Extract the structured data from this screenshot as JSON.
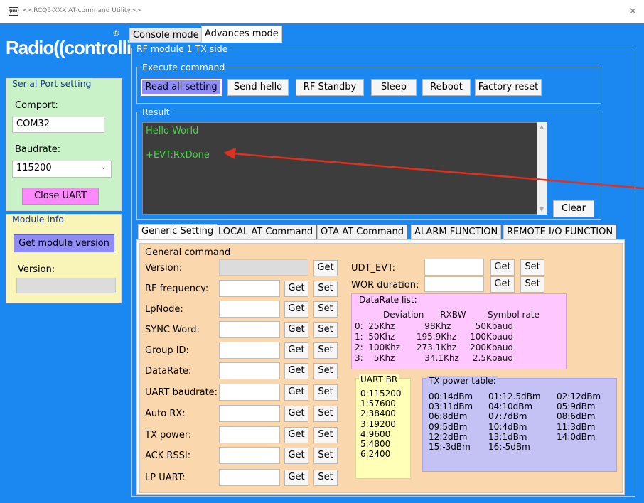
{
  "window": {
    "title": "<<RCQ5-XXX AT-command Utility>>",
    "app_icon_text": "(ini)",
    "close_glyph": "×"
  },
  "branding": {
    "logo_text": "Radio((controlli",
    "registered_mark": "®"
  },
  "serial_port": {
    "group_label": "Serial Port setting",
    "comport_label": "Comport:",
    "comport_value": "COM32",
    "baudrate_label": "Baudrate:",
    "baudrate_value": "115200",
    "close_button": "Close UART"
  },
  "module_info": {
    "group_label": "Module info",
    "get_version_button": "Get module version",
    "version_label": "Version:",
    "version_value": ""
  },
  "mode_tabs": [
    "Console mode",
    "Advances mode"
  ],
  "rf_module": {
    "group_label": "RF module 1 TX side",
    "execute_label": "Execute command",
    "commands": [
      "Read all setting",
      "Send hello",
      "RF Standby",
      "Sleep",
      "Reboot",
      "Factory reset"
    ],
    "result_label": "Result",
    "result_lines": [
      "Hello World",
      "+EVT:RxDone"
    ],
    "clear_button": "Clear"
  },
  "settings_tabs": [
    "Generic Setting",
    "LOCAL AT Command",
    "OTA AT Command",
    "ALARM FUNCTION",
    "REMOTE I/O FUNCTION"
  ],
  "general": {
    "group_label": "General command",
    "get": "Get",
    "set": "Set",
    "rows": [
      {
        "label": "Version:",
        "has_set": false
      },
      {
        "label": "RF frequency:",
        "has_set": true
      },
      {
        "label": "LpNode:",
        "has_set": true
      },
      {
        "label": "SYNC Word:",
        "has_set": true
      },
      {
        "label": "Group ID:",
        "has_set": true
      },
      {
        "label": "DataRate:",
        "has_set": true
      },
      {
        "label": "UART baudrate:",
        "has_set": true
      },
      {
        "label": "Auto RX:",
        "has_set": true
      },
      {
        "label": "TX power:",
        "has_set": true
      },
      {
        "label": "ACK RSSI:",
        "has_set": true
      },
      {
        "label": "LP UART:",
        "has_set": true
      }
    ],
    "udt_evt_label": "UDT_EVT:",
    "wor_label": "WOR duration:"
  },
  "datarate_list": {
    "title": "DataRate list:",
    "header": "           Deviation      RXBW        Symbol rate",
    "rows": [
      "0:  25Khz           98Khz         50Kbaud",
      "1:  50Khz        195.9Khz     100Kbaud",
      "2:  100Khz      273.1Khz     200Kbaud",
      "3:    5Khz           34.1Khz     2.5Kbaud"
    ]
  },
  "uart_br": {
    "title": "UART BR",
    "values": [
      "0:115200",
      "1:57600",
      "2:38400",
      "3:19200",
      "4:9600",
      "5:4800",
      "6:2400"
    ]
  },
  "tx_power": {
    "title": "TX power table:",
    "col1": [
      "00:14dBm",
      "03:11dBm",
      "06:8dBm",
      "09:5dBm",
      "12:2dBm",
      "15:-3dBm"
    ],
    "col2": [
      "01:12.5dBm",
      "04:10dBm",
      "07:7dBm",
      "10:4dBm",
      "13:1dBm",
      "16:-5dBm"
    ],
    "col3": [
      "02:12dBm",
      "05:9dBm",
      "08:6dBm",
      "11:3dBm",
      "14:0dBm"
    ]
  },
  "colors": {
    "client_bg": "#1b87f0",
    "result_text": "#46d446",
    "annotation_arrow": "#e0301e"
  }
}
